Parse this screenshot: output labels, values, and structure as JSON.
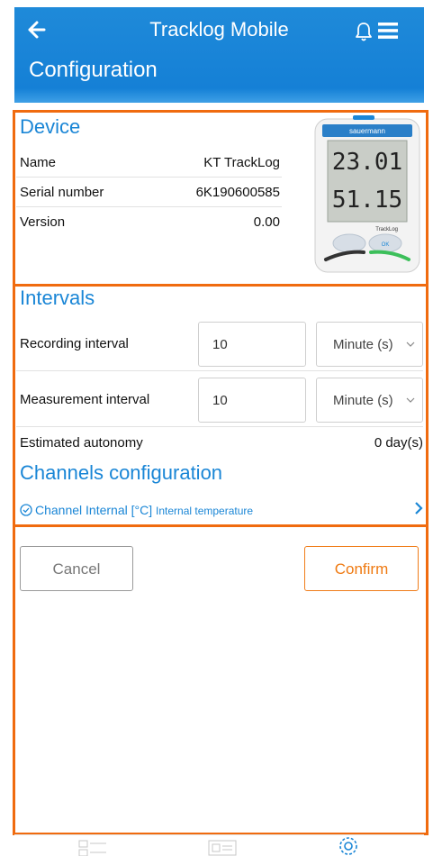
{
  "header": {
    "title": "Tracklog Mobile",
    "subtitle": "Configuration"
  },
  "device": {
    "section_title": "Device",
    "rows": [
      {
        "label": "Name",
        "value": "KT TrackLog"
      },
      {
        "label": "Serial number",
        "value": "6K190600585"
      },
      {
        "label": "Version",
        "value": "0.00"
      }
    ],
    "image": {
      "brand": "sauermann",
      "display_top": "23.01",
      "display_bottom": "51.15",
      "model_label": "TrackLog",
      "ok_label": "OK"
    }
  },
  "intervals": {
    "section_title": "Intervals",
    "recording": {
      "label": "Recording interval",
      "value": "10",
      "unit": "Minute (s)"
    },
    "measurement": {
      "label": "Measurement interval",
      "value": "10",
      "unit": "Minute (s)"
    },
    "autonomy": {
      "label": "Estimated autonomy",
      "value": "0 day(s)"
    }
  },
  "channels": {
    "section_title": "Channels configuration",
    "items": [
      {
        "label": "Channel Internal [°C]",
        "description": "Internal temperature"
      }
    ]
  },
  "actions": {
    "cancel_label": "Cancel",
    "confirm_label": "Confirm"
  },
  "tabbar": {
    "icons": [
      "list-icon",
      "card-icon",
      "settings-icon"
    ]
  },
  "colors": {
    "header_blue": "#1580d6",
    "accent_blue": "#1a86d6",
    "highlight_orange": "#f06b0f",
    "confirm_orange": "#ef7a12"
  }
}
